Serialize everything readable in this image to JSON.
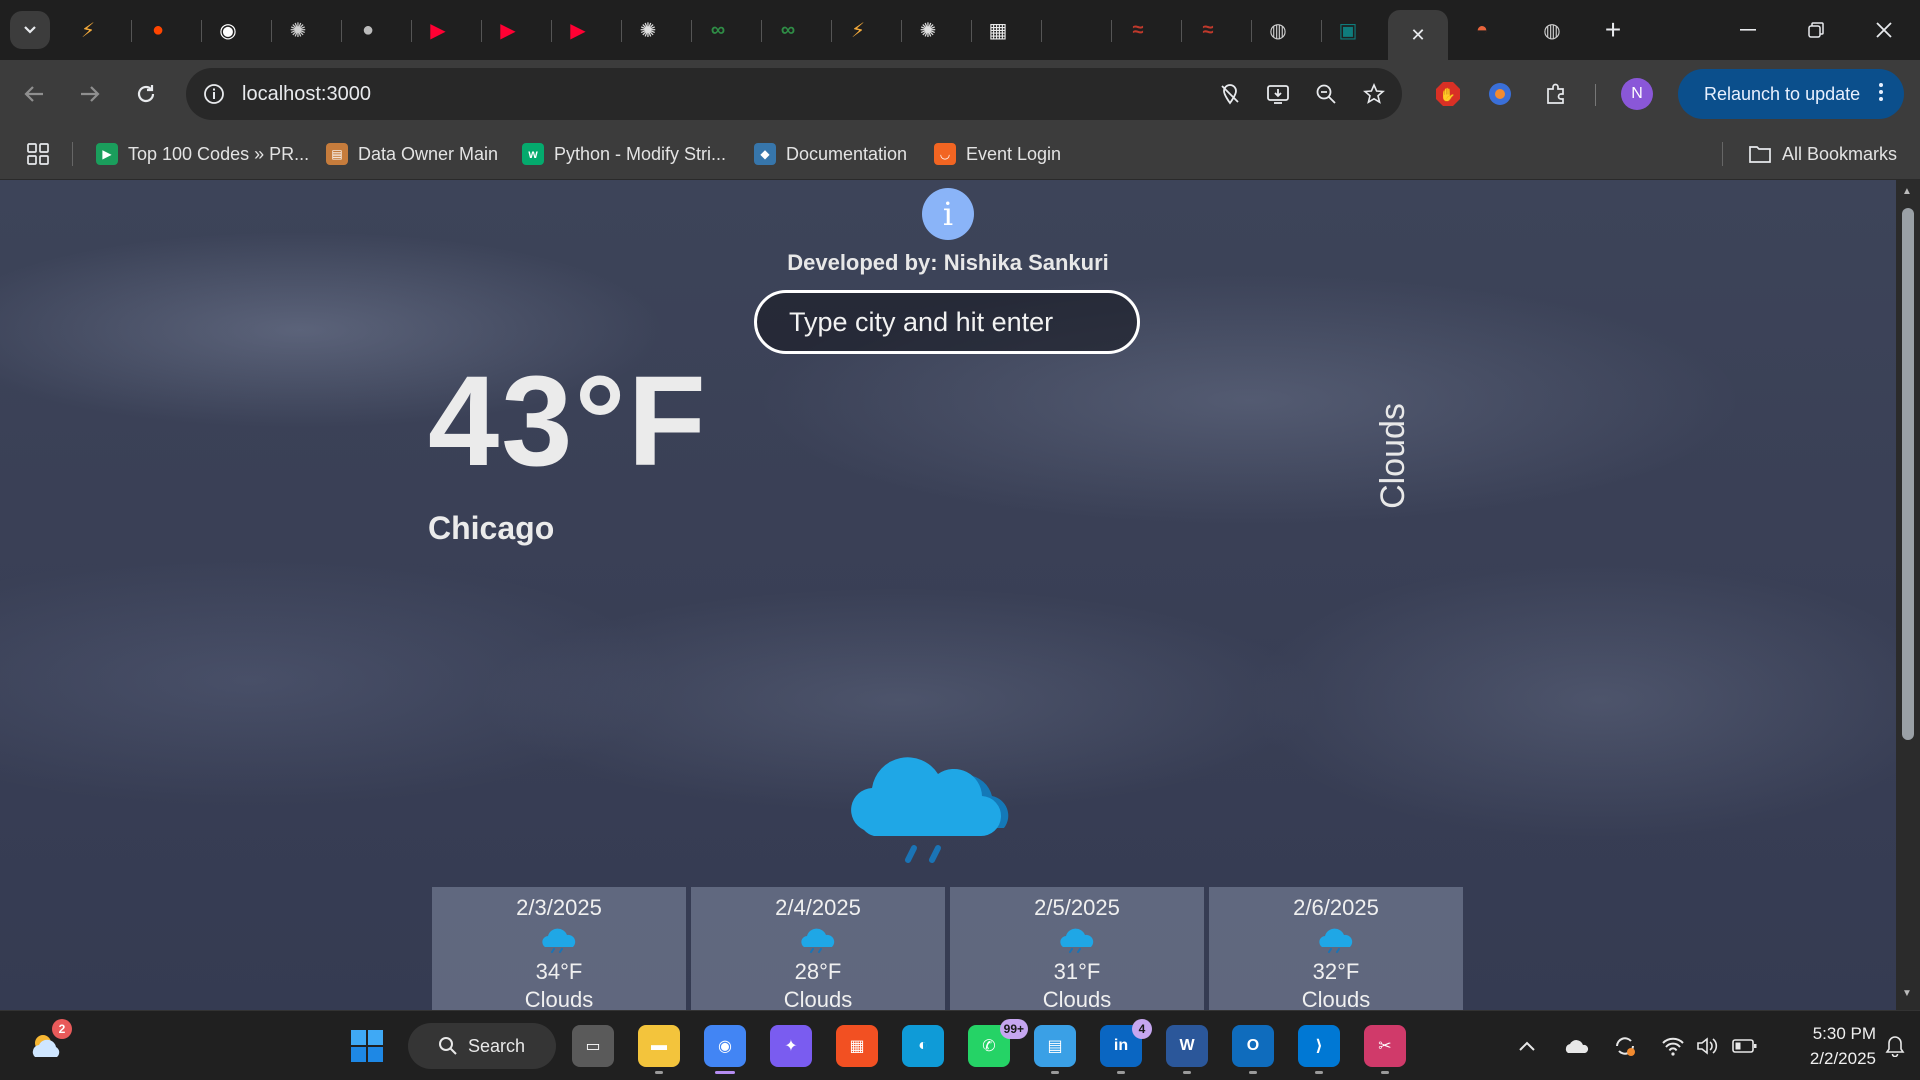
{
  "browser": {
    "tabs": [
      {
        "icon": "gfg-icon",
        "color": "#f2a93b",
        "glyph": "⚡"
      },
      {
        "icon": "reddit-icon",
        "color": "#ff4500",
        "glyph": "●"
      },
      {
        "icon": "github-icon",
        "color": "#ffffff",
        "glyph": "◉"
      },
      {
        "icon": "chatgpt-icon",
        "color": "#d0d0d0",
        "glyph": "✺"
      },
      {
        "icon": "apple-icon",
        "color": "#bbbbbb",
        "glyph": "●"
      },
      {
        "icon": "youtube-icon",
        "color": "#ff0033",
        "glyph": "▶"
      },
      {
        "icon": "youtube-icon",
        "color": "#ff0033",
        "glyph": "▶"
      },
      {
        "icon": "youtube-icon",
        "color": "#ff0033",
        "glyph": "▶"
      },
      {
        "icon": "openai-icon",
        "color": "#e0e0e0",
        "glyph": "✺"
      },
      {
        "icon": "gfg-icon",
        "color": "#2f8d46",
        "glyph": "∞"
      },
      {
        "icon": "gfg-icon",
        "color": "#2f8d46",
        "glyph": "∞"
      },
      {
        "icon": "gfg-icon",
        "color": "#f2a93b",
        "glyph": "⚡"
      },
      {
        "icon": "openai-icon",
        "color": "#e0e0e0",
        "glyph": "✺"
      },
      {
        "icon": "image-icon",
        "color": "#e8e8e8",
        "glyph": "▦"
      },
      {
        "icon": "blank-icon",
        "color": "#555555",
        "glyph": ""
      },
      {
        "icon": "flipkart-icon",
        "color": "#c0392b",
        "glyph": "≈"
      },
      {
        "icon": "flipkart-icon",
        "color": "#c0392b",
        "glyph": "≈"
      },
      {
        "icon": "globe-icon",
        "color": "#cfcfcf",
        "glyph": "◍"
      },
      {
        "icon": "app-icon",
        "color": "#0f7c7c",
        "glyph": "▣"
      }
    ],
    "active_tab_close": "✕",
    "after_tabs": [
      {
        "icon": "hardhat-icon",
        "color": "#e8643c",
        "glyph": "◓"
      },
      {
        "icon": "globe-icon",
        "color": "#cfcfcf",
        "glyph": "◍"
      }
    ],
    "new_tab": "+",
    "url": "localhost:3000",
    "relaunch_label": "Relaunch to update",
    "profile_initial": "N",
    "bookmarks": [
      {
        "label": "Top 100 Codes » PR...",
        "icon": "codes-icon",
        "color": "#1a9e5c",
        "glyph": "▶"
      },
      {
        "label": "Data Owner Main",
        "icon": "data-owner-icon",
        "color": "#c67c3c",
        "glyph": "▤"
      },
      {
        "label": "Python - Modify Stri...",
        "icon": "w3schools-icon",
        "color": "#04aa6d",
        "glyph": "w"
      },
      {
        "label": "Documentation",
        "icon": "python-icon",
        "color": "#3776ab",
        "glyph": "◆"
      },
      {
        "label": "Event Login",
        "icon": "event-icon",
        "color": "#f26522",
        "glyph": "◡"
      }
    ],
    "all_bookmarks": "All Bookmarks"
  },
  "app": {
    "info_label": "i",
    "developer": "Developed by: Nishika Sankuri",
    "search_placeholder": "Type city and hit enter",
    "temperature": "43°F",
    "city": "Chicago",
    "condition": "Clouds",
    "forecast": [
      {
        "date": "2/3/2025",
        "temp": "34°F",
        "desc": "Clouds"
      },
      {
        "date": "2/4/2025",
        "temp": "28°F",
        "desc": "Clouds"
      },
      {
        "date": "2/5/2025",
        "temp": "31°F",
        "desc": "Clouds"
      },
      {
        "date": "2/6/2025",
        "temp": "32°F",
        "desc": "Clouds"
      }
    ]
  },
  "taskbar": {
    "weather_badge": "2",
    "search_label": "Search",
    "whatsapp_badge": "99+",
    "linkedin_badge": "4",
    "time": "5:30 PM",
    "date": "2/2/2025",
    "apps": [
      {
        "name": "taskview-icon",
        "color": "#5a5a5a",
        "glyph": "▭"
      },
      {
        "name": "file-explorer-icon",
        "color": "#f3c43c",
        "glyph": "▬"
      },
      {
        "name": "chrome-icon",
        "color": "#4285f4",
        "glyph": "◉"
      },
      {
        "name": "copilot-icon",
        "color": "#7a5cf0",
        "glyph": "✦"
      },
      {
        "name": "store-icon",
        "color": "#f25022",
        "glyph": "▦"
      },
      {
        "name": "edge-icon",
        "color": "#0f9bd7",
        "glyph": "◐"
      },
      {
        "name": "whatsapp-icon",
        "color": "#25d366",
        "glyph": "✆"
      },
      {
        "name": "notepad-icon",
        "color": "#3aa0e6",
        "glyph": "▤"
      },
      {
        "name": "linkedin-icon",
        "color": "#0a66c2",
        "glyph": "in"
      },
      {
        "name": "word-icon",
        "color": "#2b579a",
        "glyph": "W"
      },
      {
        "name": "outlook-icon",
        "color": "#0f6cbd",
        "glyph": "O"
      },
      {
        "name": "vscode-icon",
        "color": "#0078d4",
        "glyph": "⟩"
      },
      {
        "name": "snipping-icon",
        "color": "#d03a6a",
        "glyph": "✂"
      }
    ]
  }
}
